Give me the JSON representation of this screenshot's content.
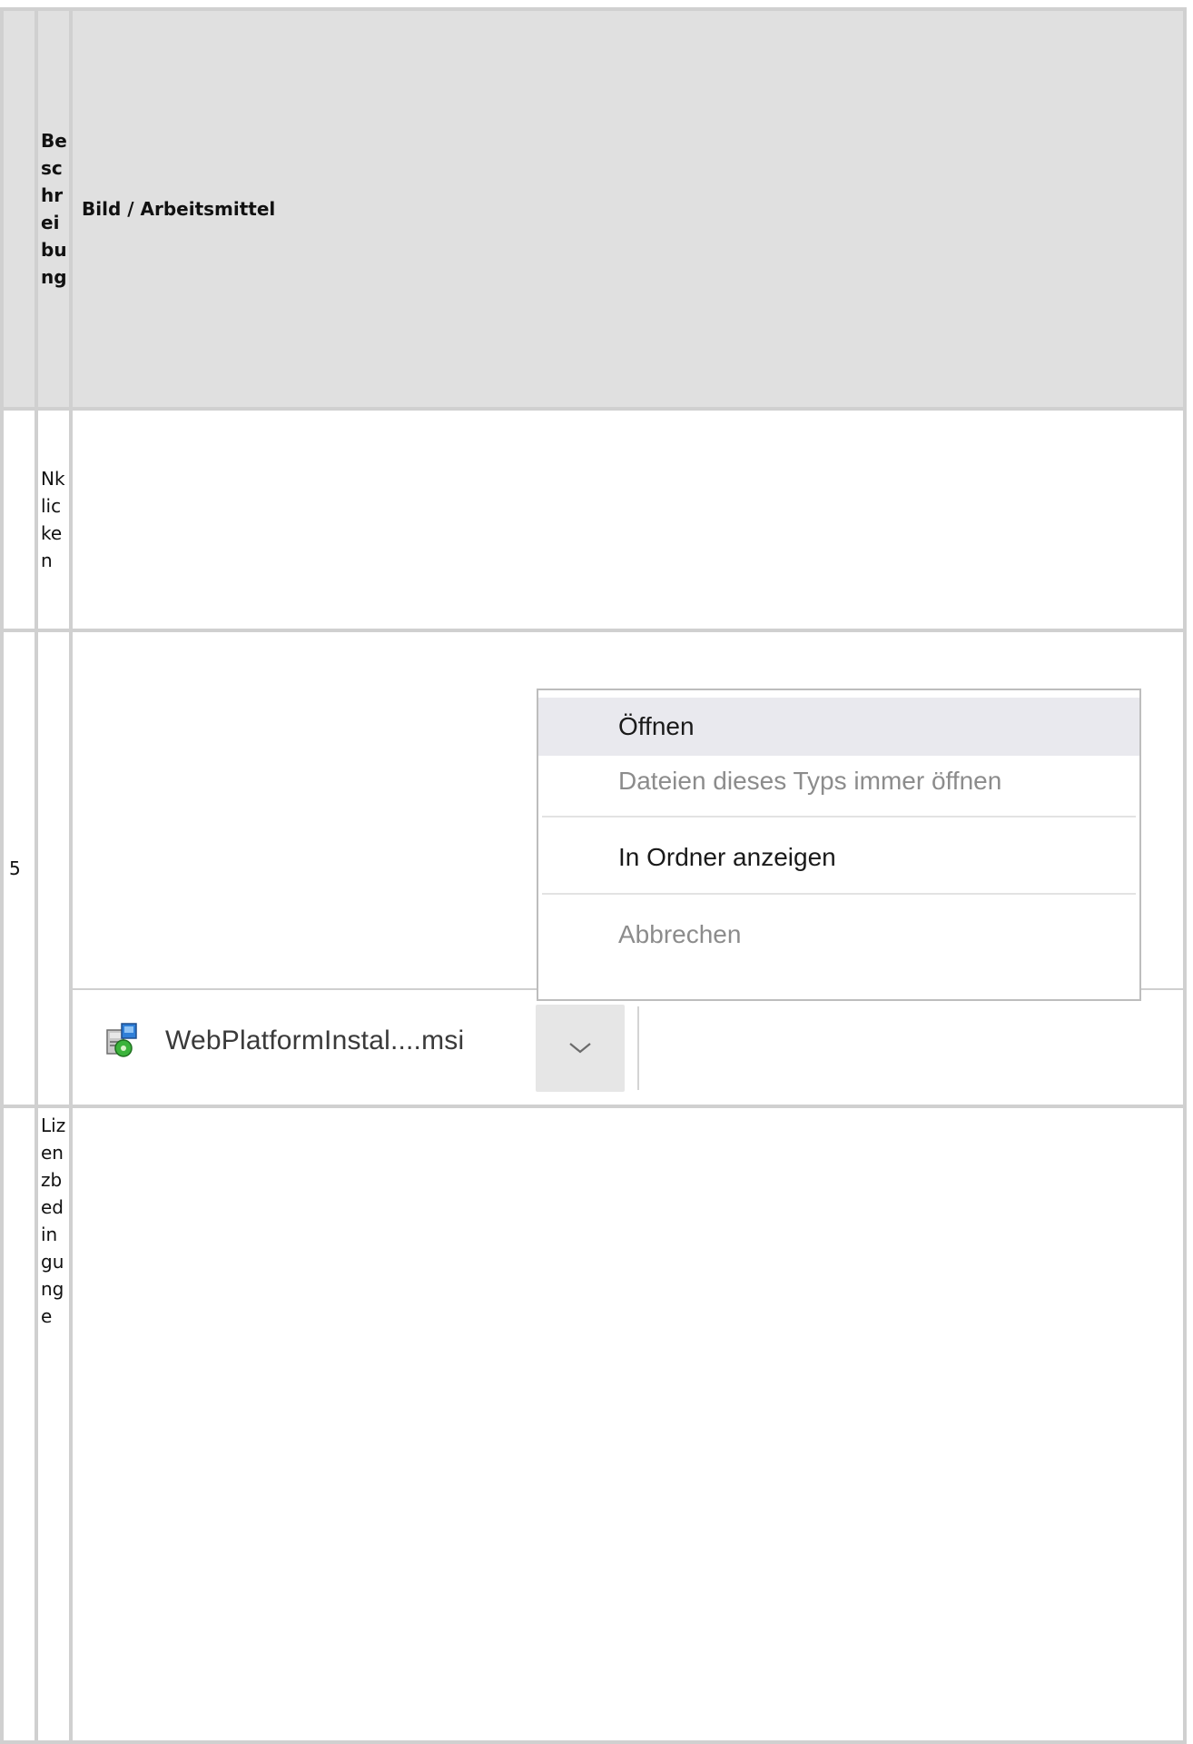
{
  "table": {
    "header": {
      "col1_label": "Beschreibung",
      "col2_label": "Bild / Arbeitsmittel"
    },
    "rows": [
      {
        "step": "",
        "description": "Nklicken"
      },
      {
        "step": "5",
        "description": ""
      },
      {
        "step": "",
        "description": "Lizenzbedingunge"
      }
    ]
  },
  "screenshot": {
    "download_bar": {
      "file_name": "WebPlatformInstal....msi",
      "file_icon": "msi-installer-icon",
      "dropdown_icon": "chevron-down-icon"
    },
    "context_menu": {
      "items": [
        {
          "label": "Öffnen",
          "state": "hover"
        },
        {
          "label": "Dateien dieses Typs immer öffnen",
          "state": "disabled"
        },
        {
          "label": "In Ordner anzeigen",
          "state": "enabled"
        },
        {
          "label": "Abbrechen",
          "state": "disabled"
        }
      ]
    }
  },
  "colors": {
    "header_bg": "#e0e0e0",
    "grid_border": "#d0d0d0",
    "menu_hover_bg": "#e9e9ee",
    "disabled_text": "#8c8c8c",
    "dropdown_button_bg": "#e6e6e6"
  }
}
